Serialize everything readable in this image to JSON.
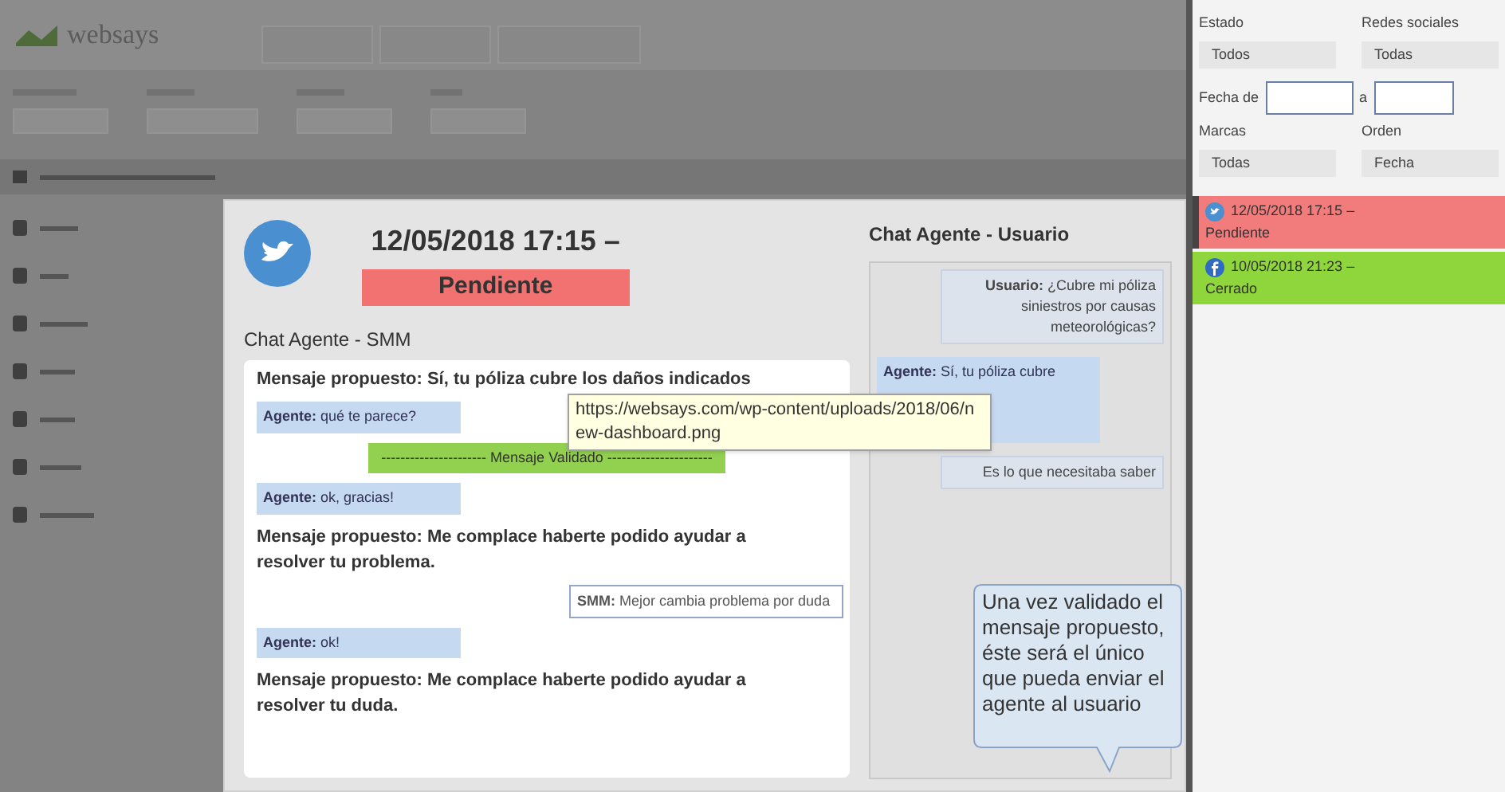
{
  "app": {
    "logo": "websays"
  },
  "modal": {
    "date": "12/05/2018 17:15 –",
    "status": "Pendiente"
  },
  "chat_smm": {
    "title": "Chat Agente - SMM",
    "messages": [
      {
        "kind": "proposed",
        "text": "Mensaje propuesto: Sí, tu póliza cubre los daños indicados"
      },
      {
        "kind": "agent",
        "text": "**Agente:** qué te parece?"
      },
      {
        "kind": "validated",
        "text": "---------------------- Mensaje Validado ----------------------"
      },
      {
        "kind": "agent",
        "text": "**Agente:** ok, gracias!"
      },
      {
        "kind": "proposed",
        "text": "Mensaje propuesto: Me complace haberte podido ayudar a resolver tu problema."
      },
      {
        "kind": "smm",
        "text": "**SMM:** Mejor cambia problema por duda"
      },
      {
        "kind": "agent",
        "text": "**Agente:** ok!"
      },
      {
        "kind": "proposed",
        "text": "Mensaje propuesto: Me complace haberte podido ayudar a resolver tu duda."
      }
    ]
  },
  "chat_user": {
    "title": "Chat Agente - Usuario",
    "messages": [
      {
        "kind": "user",
        "text": "**Usuario:** ¿Cubre mi póliza siniestros por causas meteorológicas?"
      },
      {
        "kind": "agent",
        "text": "**Agente:** Sí, tu póliza cubre"
      },
      {
        "kind": "user",
        "text": "Es lo que necesitaba saber"
      }
    ]
  },
  "tooltip": {
    "text": "https://websays.com/wp-content/uploads/2018/06/new-dashboard.png"
  },
  "callout": {
    "text": "Una vez validado el mensaje propuesto, éste será el único que pueda enviar el agente al usuario"
  },
  "filters": {
    "estado": {
      "label": "Estado",
      "value": "Todos"
    },
    "redes": {
      "label": "Redes sociales",
      "value": "Todas"
    },
    "fecha": {
      "label": "Fecha de",
      "to_label": "a"
    },
    "marcas": {
      "label": "Marcas",
      "value": "Todas"
    },
    "orden": {
      "label": "Orden",
      "value": "Fecha"
    }
  },
  "conversations": [
    {
      "kind": "twitter",
      "date": "12/05/2018 17:15 –",
      "status": "Pendiente",
      "color": "#f27c7c",
      "selected": true
    },
    {
      "kind": "facebook",
      "date": "10/05/2018 21:23 –",
      "status": "Cerrado",
      "color": "#8fd63c",
      "selected": false
    }
  ]
}
